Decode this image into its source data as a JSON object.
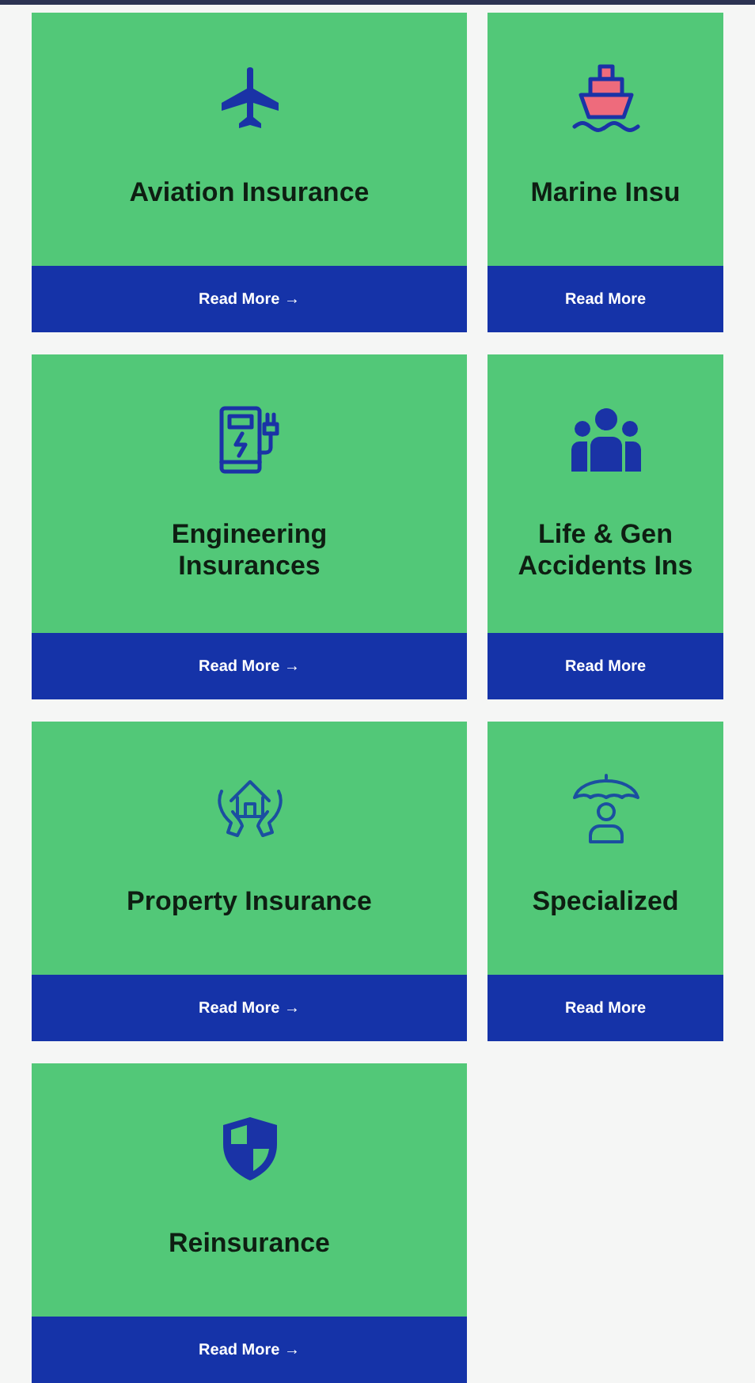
{
  "cards": [
    {
      "title": "Aviation Insurance",
      "button": "Read More →"
    },
    {
      "title": "Marine Insu",
      "button": "Read More"
    },
    {
      "title": "Engineering\nInsurances",
      "button": "Read More →"
    },
    {
      "title": "Life & Gen\nAccidents Ins",
      "button": "Read More"
    },
    {
      "title": "Property Insurance",
      "button": "Read More →"
    },
    {
      "title": "Specialized",
      "button": "Read More"
    },
    {
      "title": "Reinsurance",
      "button": "Read More →"
    }
  ]
}
